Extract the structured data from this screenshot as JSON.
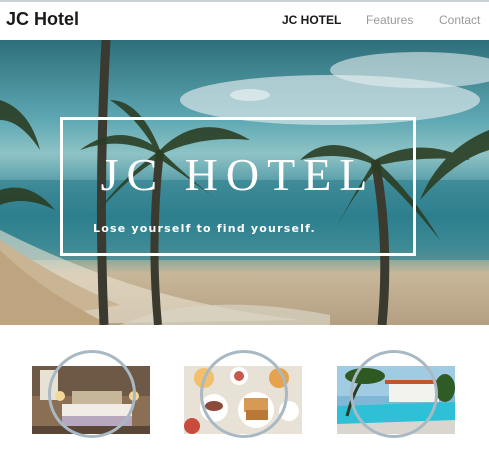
{
  "navbar": {
    "brand": "JC Hotel",
    "links": [
      {
        "label": "JC HOTEL",
        "active": true
      },
      {
        "label": "Features",
        "active": false
      },
      {
        "label": "Contact",
        "active": false
      }
    ]
  },
  "hero": {
    "title": "JC HOTEL",
    "tagline": "Lose yourself to find yourself."
  },
  "features": [
    {
      "image": "hotel-bedroom"
    },
    {
      "image": "breakfast-table"
    },
    {
      "image": "resort-pool"
    }
  ],
  "colors": {
    "ring": "#a9b9c4",
    "nav_inactive": "#9a9a9a",
    "nav_active": "#1a1a1a"
  }
}
